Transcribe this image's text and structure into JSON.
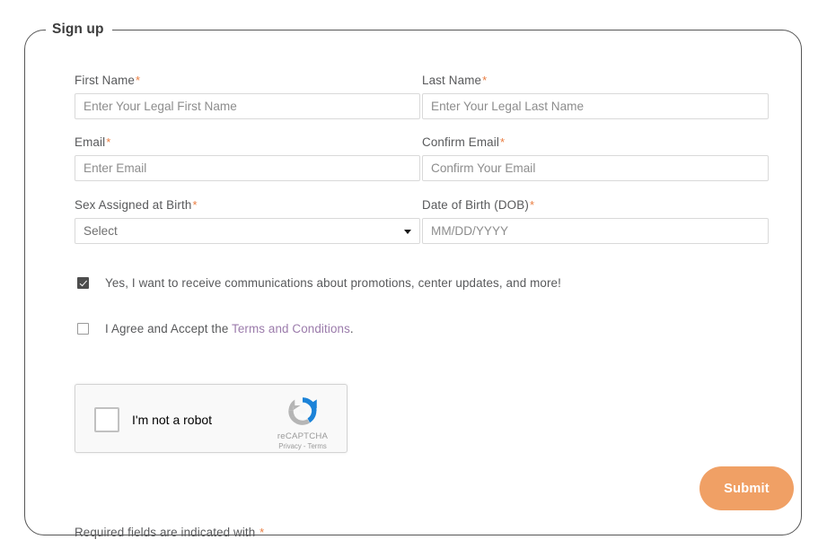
{
  "form": {
    "legend": "Sign up",
    "required_star": "*",
    "fields": [
      {
        "id": "first-name",
        "label": "First Name",
        "required": true,
        "type": "text",
        "placeholder": "Enter Your Legal First Name",
        "value": ""
      },
      {
        "id": "last-name",
        "label": "Last Name",
        "required": true,
        "type": "text",
        "placeholder": "Enter Your Legal Last Name",
        "value": ""
      },
      {
        "id": "email",
        "label": "Email",
        "required": true,
        "type": "text",
        "placeholder": "Enter Email",
        "value": ""
      },
      {
        "id": "confirm-email",
        "label": "Confirm Email",
        "required": true,
        "type": "text",
        "placeholder": "Confirm Your Email",
        "value": ""
      },
      {
        "id": "sex-assigned-at-birth",
        "label": "Sex Assigned at Birth",
        "required": true,
        "type": "select",
        "selected": "Select",
        "value": ""
      },
      {
        "id": "date-of-birth",
        "label": "Date of Birth (DOB)",
        "required": true,
        "type": "text",
        "placeholder": "MM/DD/YYYY",
        "value": ""
      }
    ],
    "consents": [
      {
        "id": "marketing-opt-in",
        "checked": true,
        "text": "Yes, I want to receive communications about promotions, center updates, and more!"
      },
      {
        "id": "terms-agreement",
        "checked": false,
        "text_before": "I Agree and Accept the ",
        "link_text": "Terms and Conditions",
        "text_after": "."
      }
    ],
    "recaptcha": {
      "label": "I'm not a robot",
      "brand": "reCAPTCHA",
      "legal": "Privacy - Terms",
      "checked": false
    },
    "submit_label": "Submit",
    "footer_note": "Required fields are indicated with ",
    "footer_star": "*"
  },
  "colors": {
    "accent_orange": "#f0a065",
    "required_star": "#ea7d41",
    "link_purple": "#9b7bab",
    "label_gray": "#58595b",
    "border_gray": "#d9d9d9",
    "frame_gray": "#565656"
  }
}
